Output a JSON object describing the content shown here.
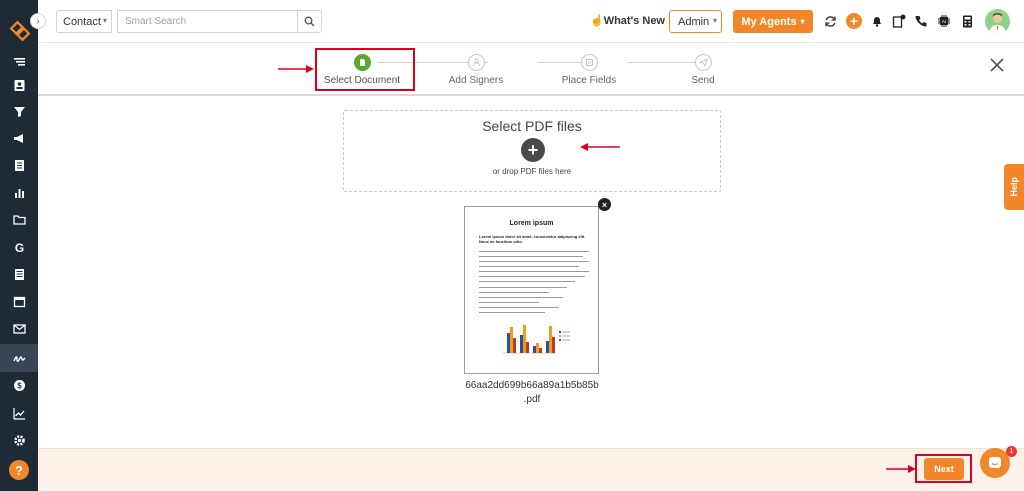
{
  "topbar": {
    "contact_select": "Contact",
    "search_placeholder": "Smart Search",
    "whats_new": "What's New",
    "admin_select": "Admin",
    "agents_button": "My Agents"
  },
  "stepper": {
    "steps": [
      {
        "label": "Select Document",
        "state": "active"
      },
      {
        "label": "Add Signers",
        "state": "pending"
      },
      {
        "label": "Place Fields",
        "state": "pending"
      },
      {
        "label": "Send",
        "state": "pending"
      }
    ]
  },
  "upload": {
    "title": "Select PDF files",
    "hint": "or drop PDF files here"
  },
  "document": {
    "preview_title": "Lorem ipsum",
    "preview_subtitle": "Lorem ipsum dolor sit amet, consectetur adipiscing elit. Nunc ac faucibus odio.",
    "filename_line1": "66aa2dd699b66a89a1b5b85b",
    "filename_line2": ".pdf"
  },
  "footer": {
    "next_button": "Next",
    "chat_badge": "1"
  },
  "help_tab": "Help",
  "colors": {
    "sidebar": "#1f2a37",
    "accent": "#f2872a",
    "step_active": "#5aa832",
    "annotation": "#e0001b"
  }
}
